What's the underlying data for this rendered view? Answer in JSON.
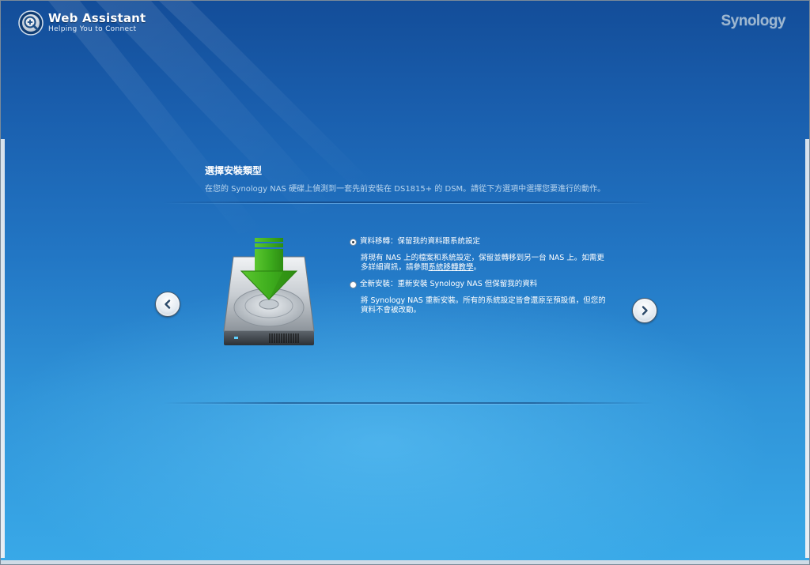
{
  "header": {
    "app_title": "Web Assistant",
    "app_subtitle": "Helping You to Connect",
    "vendor_logo": "Synology"
  },
  "content": {
    "title": "選擇安裝類型",
    "description": "在您的 Synology NAS 硬碟上偵測到一套先前安裝在 DS1815+ 的 DSM。請從下方選項中選擇您要進行的動作。",
    "options": [
      {
        "label": "資料移轉：保留我的資料跟系統設定",
        "selected": true,
        "description_before_link": "將現有 NAS 上的檔案和系統設定，保留並轉移到另一台 NAS 上。如需更多詳細資訊，請參閱",
        "link_text": "系統移轉教學",
        "description_after_link": "。"
      },
      {
        "label": "全新安裝：重新安裝 Synology NAS 但保留我的資料",
        "selected": false,
        "description": "將 Synology NAS 重新安裝。所有的系統設定皆會還原至預設值，但您的資料不會被改動。"
      }
    ]
  },
  "navigation": {
    "prev_icon": "chevron-left-icon",
    "next_icon": "chevron-right-icon"
  },
  "colors": {
    "background_top": "#134d99",
    "background_bottom": "#39a9e8",
    "arrow_green": "#3fae1e",
    "text_white": "#ffffff",
    "desc_text": "#b9d5ee"
  }
}
